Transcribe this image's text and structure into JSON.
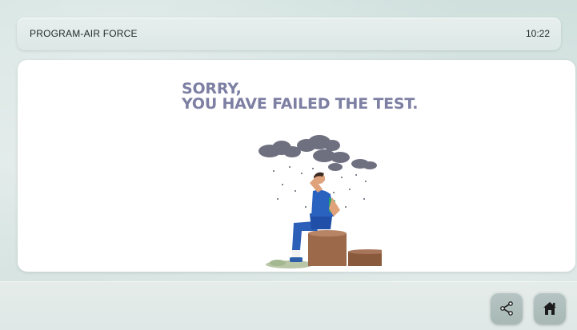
{
  "header": {
    "title": "PROGRAM-AIR FORCE",
    "time": "10:22"
  },
  "result": {
    "line1": "SORRY,",
    "line2": "YOU HAVE FAILED THE TEST."
  },
  "illustration": {
    "icon": "sad-athlete-rain-illustration"
  },
  "footer": {
    "share_icon": "share-icon",
    "home_icon": "home-icon"
  },
  "colors": {
    "message": "#7d7fa3",
    "card": "#ffffff",
    "button": "#a7b8b5"
  }
}
